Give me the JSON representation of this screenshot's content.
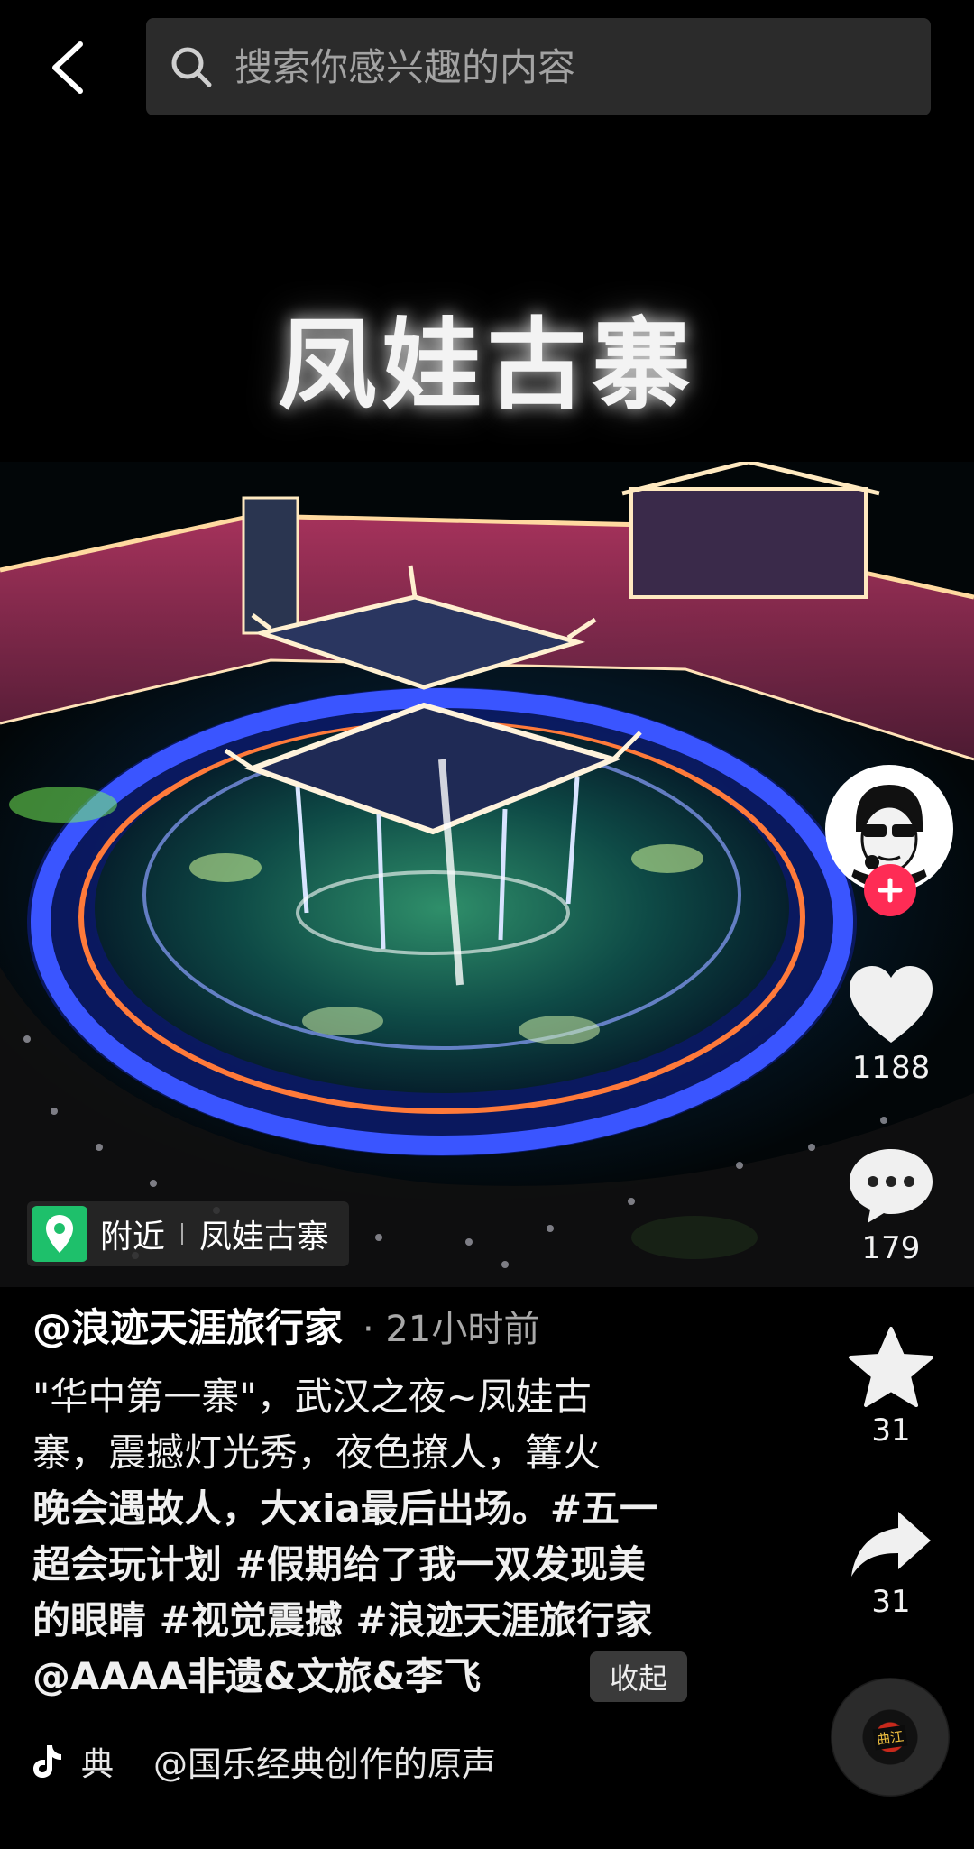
{
  "search": {
    "placeholder": "搜索你感兴趣的内容"
  },
  "video": {
    "title_overlay": "凤娃古寨"
  },
  "location": {
    "label": "附近",
    "place": "凤娃古寨"
  },
  "actions": {
    "like_count": "1188",
    "comment_count": "179",
    "favorite_count": "31",
    "share_count": "31"
  },
  "post": {
    "author": "@浪迹天涯旅行家",
    "time": "· 21小时前",
    "caption_lines": [
      "\"华中第一寨\"，武汉之夜~凤娃古",
      "寨，震撼灯光秀，夜色撩人，篝火",
      "晚会遇故人，大xia最后出场。#五一",
      "超会玩计划 #假期给了我一双发现美",
      "的眼睛 #视觉震撼 #浪迹天涯旅行家",
      "@AAAA非遗&文旅&李飞"
    ],
    "collapse_label": "收起"
  },
  "music": {
    "tag": "典",
    "title": "@国乐经典创作的原声",
    "disc_label": "曲江"
  },
  "colors": {
    "background": "#000000",
    "follow_red": "#fe2c55",
    "location_green": "#1ec06b",
    "search_bg": "#2b2b2b"
  }
}
